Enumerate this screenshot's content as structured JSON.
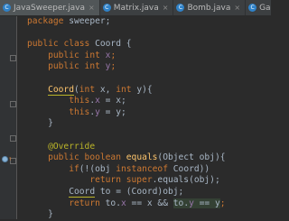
{
  "tabs": [
    {
      "icon": "C",
      "label": "JavaSweeper.java",
      "close": "×"
    },
    {
      "icon": "C",
      "label": "Matrix.java",
      "close": "×"
    },
    {
      "icon": "C",
      "label": "Bomb.java",
      "close": "×"
    },
    {
      "icon": "C",
      "label": "Game.",
      "close": ""
    }
  ],
  "code": {
    "l1": {
      "kw": "package ",
      "rest": "sweeper;"
    },
    "l3": {
      "kw1": "public ",
      "kw2": "class ",
      "name": "Coord",
      "rest": " {"
    },
    "l4": {
      "kw1": "public ",
      "kw2": "int ",
      "field": "x",
      "rest": ";"
    },
    "l5": {
      "kw1": "public ",
      "kw2": "int ",
      "field": "y",
      "rest": ";"
    },
    "l7": {
      "name": "Coord",
      "p1": "(",
      "k1": "int ",
      "p2": "x, ",
      "k2": "int ",
      "p3": "y){"
    },
    "l8": {
      "kw": "this",
      "dot": ".",
      "field": "x",
      "rest": " = x;"
    },
    "l9": {
      "kw": "this",
      "dot": ".",
      "field": "y",
      "rest": " = y;"
    },
    "l10": {
      "rest": "}"
    },
    "l12": {
      "anno": "@Override"
    },
    "l13": {
      "kw1": "public ",
      "kw2": "boolean ",
      "name": "equals",
      "rest": "(Object obj){"
    },
    "l14": {
      "kw1": "if",
      "p1": "(!(obj ",
      "kw2": "instanceof ",
      "rest": "Coord))"
    },
    "l15": {
      "kw1": "return ",
      "kw2": "super",
      "rest": ".equals(obj);"
    },
    "l16": {
      "name": "Coord",
      "rest": " to = (Coord)obj;"
    },
    "l17": {
      "kw": "return ",
      "p1": "to.",
      "f1": "x",
      "p2": " == ",
      "f2": "x",
      "p3": " && ",
      "hl1": "to.",
      "hlf1": "y",
      "hl2": " == ",
      "hlf2": "y",
      "end": ";"
    },
    "l18": {
      "rest": "}"
    }
  }
}
